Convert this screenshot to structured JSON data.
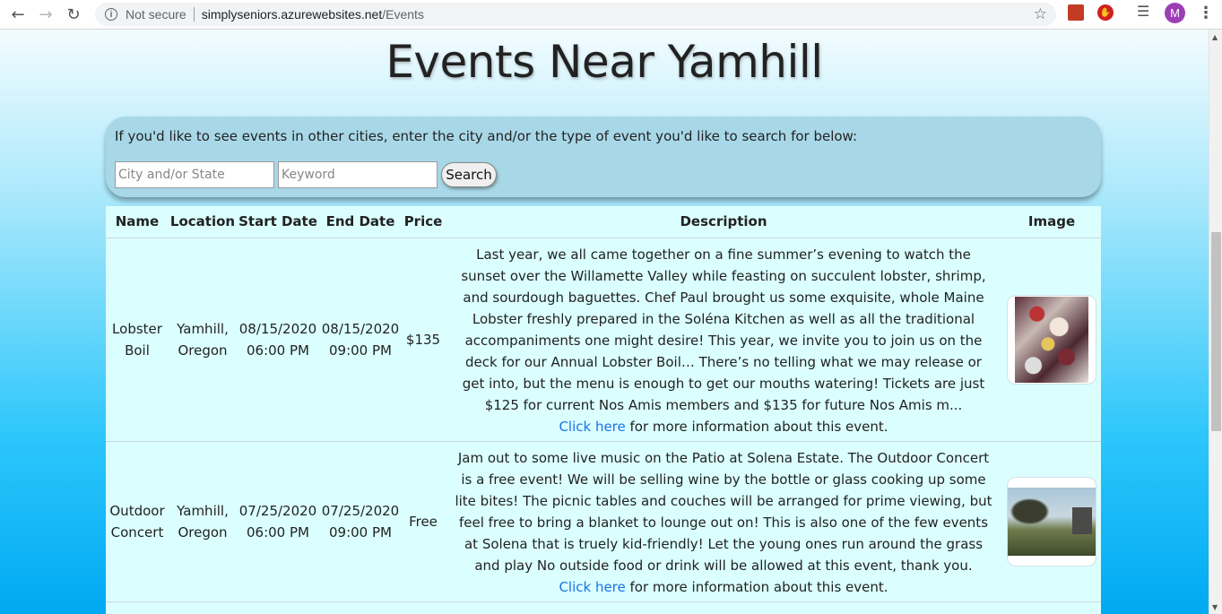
{
  "browser": {
    "security_label": "Not secure",
    "url_host": "simplyseniors.azurewebsites.net",
    "url_path": "/Events",
    "profile_initial": "M"
  },
  "page": {
    "title": "Events Near Yamhill"
  },
  "search": {
    "prompt": "If you'd like to see events in other cities, enter the city and/or the type of event you'd like to search for below:",
    "city_placeholder": "City and/or State",
    "keyword_placeholder": "Keyword",
    "button_label": "Search"
  },
  "table": {
    "headers": [
      "Name",
      "Location",
      "Start Date",
      "End Date",
      "Price",
      "Description",
      "Image"
    ],
    "link_text": "Click here",
    "link_suffix": " for more information about this event.",
    "rows": [
      {
        "name": "Lobster Boil",
        "location": "Yamhill, Oregon",
        "start_date": "08/15/2020",
        "start_time": "06:00 PM",
        "end_date": "08/15/2020",
        "end_time": "09:00 PM",
        "price": "$135",
        "description": "Last year, we all came together on a fine summer’s evening to watch the sunset over the Willamette Valley while feasting on succulent lobster, shrimp, and sourdough baguettes. Chef Paul brought us some exquisite, whole Maine Lobster freshly prepared in the Soléna Kitchen as well as all the traditional accompaniments one might desire! This year, we invite you to join us on the deck for our Annual Lobster Boil… There’s no telling what we may release or get into, but the menu is enough to get our mouths watering! Tickets are just $125 for current Nos Amis members and $135 for future Nos Amis m..."
      },
      {
        "name": "Outdoor Concert",
        "location": "Yamhill, Oregon",
        "start_date": "07/25/2020",
        "start_time": "06:00 PM",
        "end_date": "07/25/2020",
        "end_time": "09:00 PM",
        "price": "Free",
        "description": "Jam out to some live music on the Patio at Solena Estate. The Outdoor Concert is a free event! We will be selling wine by the bottle or glass cooking up some lite bites! The picnic tables and couches will be arranged for prime viewing, but feel free to bring a blanket to lounge out on! This is also one of the few events at Solena that is truely kid-friendly! Let the young ones run around the grass and play No outside food or drink will be allowed at this event, thank you."
      }
    ]
  }
}
